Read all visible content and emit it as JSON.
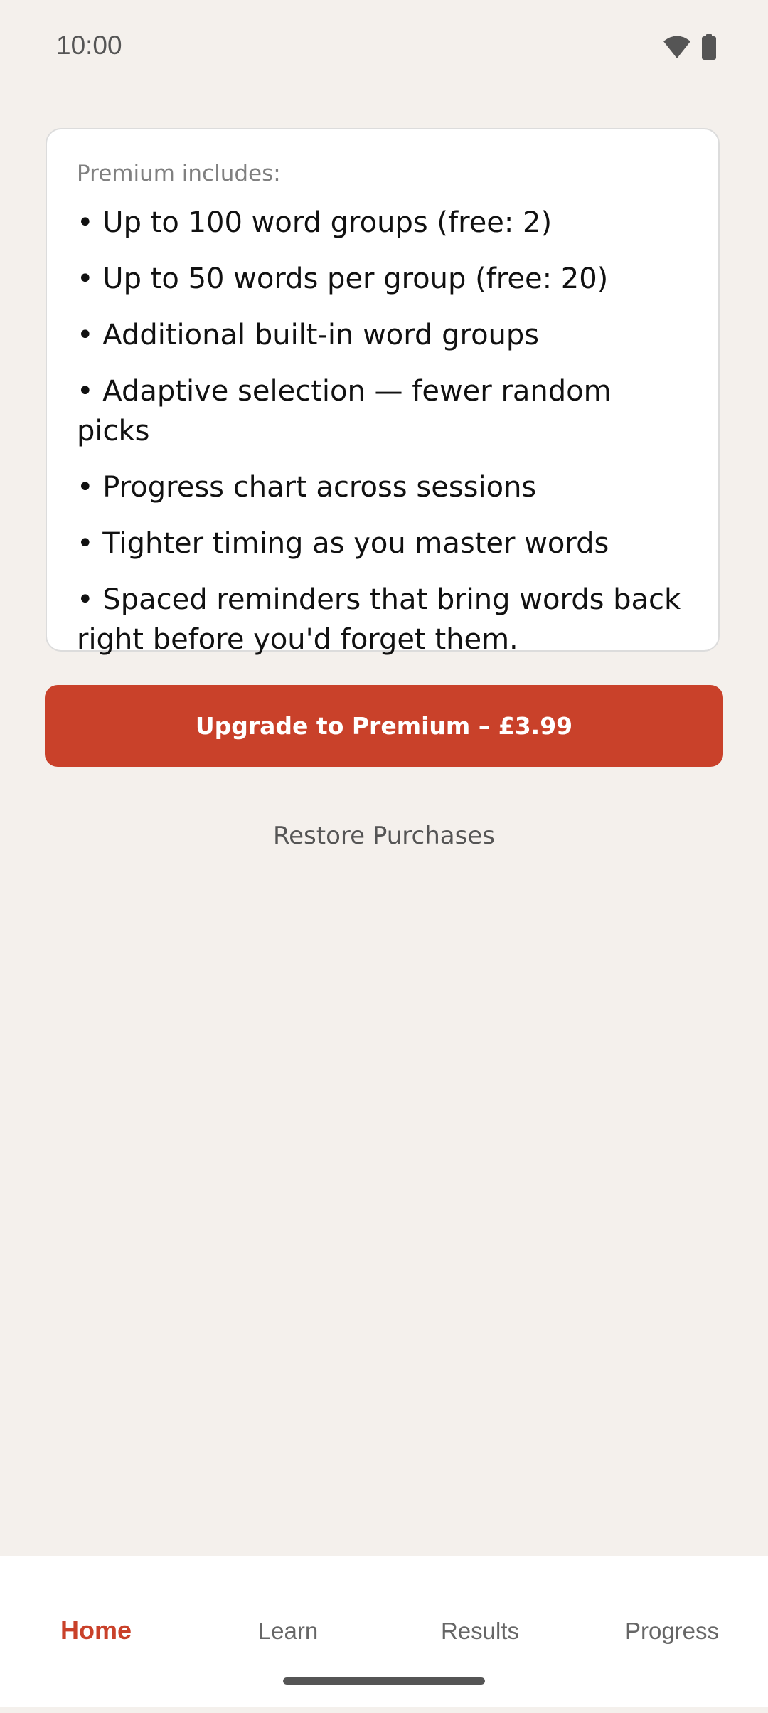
{
  "status_bar": {
    "time": "10:00",
    "icons": [
      "wifi-icon",
      "battery-icon"
    ]
  },
  "premium_card": {
    "heading": "Premium includes:",
    "features": [
      "• Up to 100 word groups (free: 2)",
      "• Up to 50 words per group (free: 20)",
      "• Additional built-in word groups",
      "• Adaptive selection — fewer random picks",
      "• Progress chart across sessions",
      "• Tighter timing as you master words",
      "• Spaced reminders that bring words back right before you'd forget them."
    ]
  },
  "actions": {
    "upgrade_label": "Upgrade to Premium – £3.99",
    "restore_label": "Restore Purchases"
  },
  "bottom_nav": {
    "tabs": [
      {
        "label": "Home",
        "active": true
      },
      {
        "label": "Learn",
        "active": false
      },
      {
        "label": "Results",
        "active": false
      },
      {
        "label": "Progress",
        "active": false
      }
    ]
  },
  "colors": {
    "accent": "#c9412a",
    "background": "#f4f0ec",
    "card": "#ffffff"
  }
}
